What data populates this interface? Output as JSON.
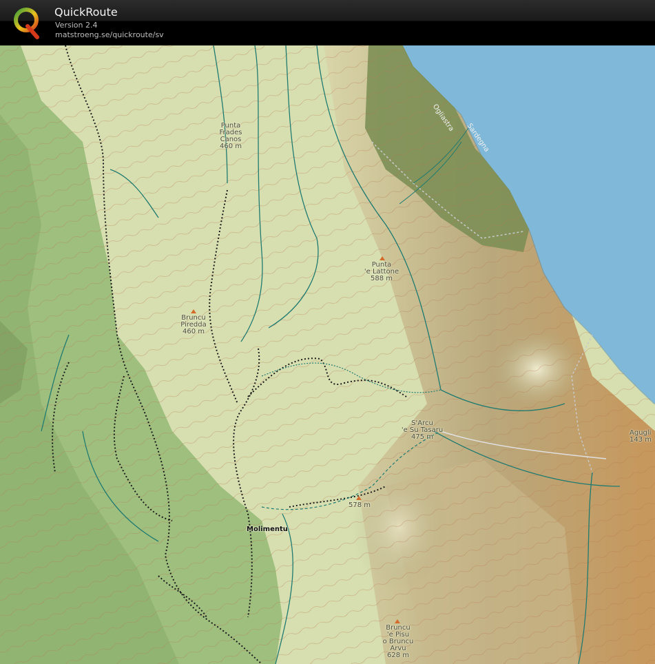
{
  "app": {
    "title": "QuickRoute",
    "version": "Version 2.4",
    "url": "matstroeng.se/quickroute/sv",
    "logo_letter": "Q"
  },
  "colors": {
    "sea": "#7fb8d9",
    "meadow": "#d9e2b4",
    "forest": "#9fbf7f",
    "scrub": "#7c8f55",
    "contour": "#b5744a",
    "stream": "#1f7a70",
    "path": "#1a1a1a"
  },
  "map": {
    "peaks": [
      {
        "name": "Punta\nFrades\nCanos\n460 m"
      },
      {
        "name": "Punta\n'e Lattone\n588 m"
      },
      {
        "name": "Bruncu\nPiredda\n460 m"
      },
      {
        "name": "S'Arcu\n'e Su Tasaru\n475 m"
      },
      {
        "name": "578 m"
      },
      {
        "name": "Bruncu\n'e Pisu\no Bruncu\nArvu\n628 m"
      },
      {
        "name": "Agugli\n143 m"
      }
    ],
    "places": [
      {
        "name": "Molimentu"
      }
    ],
    "coast_labels": [
      {
        "name": "Ogliastra"
      },
      {
        "name": "Sardegna"
      }
    ]
  }
}
